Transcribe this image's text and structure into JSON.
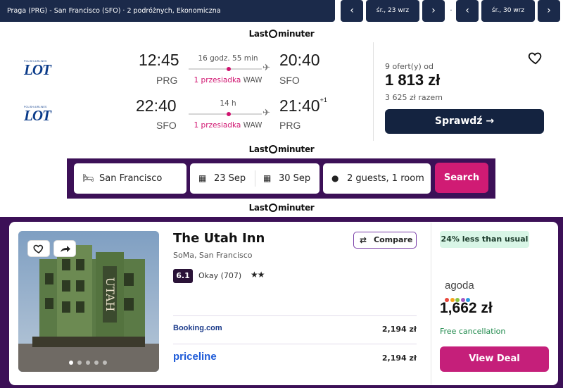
{
  "flight_search": {
    "route_summary": "Praga (PRG) - San Francisco (SFO)  ·  2 podróżnych, Ekonomiczna",
    "depart_date": "śr., 23 wrz",
    "return_date": "śr., 30 wrz",
    "separator": "·"
  },
  "brand": {
    "left": "Last",
    "right": "minuter"
  },
  "flight": {
    "airline": {
      "name": "LOT",
      "small": "POLISH AIRLINES"
    },
    "outbound": {
      "depart_time": "12:45",
      "depart_code": "PRG",
      "duration": "16 godz. 55 min",
      "stops_label": "1 przesiadka",
      "stop_code": "WAW",
      "arrive_time": "20:40",
      "arrive_code": "SFO",
      "day_offset": ""
    },
    "inbound": {
      "depart_time": "22:40",
      "depart_code": "SFO",
      "duration": "14 h",
      "stops_label": "1 przesiadka",
      "stop_code": "WAW",
      "arrive_time": "21:40",
      "arrive_code": "PRG",
      "day_offset": "+1"
    },
    "offers_label": "9 ofert(y) od",
    "price": "1 813 zł",
    "total_label": "3 625 zł razem",
    "check_label": "Sprawdź"
  },
  "hotel_search": {
    "destination": "San Francisco",
    "checkin": "23 Sep",
    "checkout": "30 Sep",
    "guests": "2 guests, 1 room",
    "search_label": "Search"
  },
  "hotel": {
    "name": "The Utah Inn",
    "location": "SoMa, San Francisco",
    "score": "6.1",
    "score_text": "Okay (707)",
    "stars": "★★",
    "compare_label": "Compare",
    "providers": [
      {
        "name": "Booking.com",
        "price": "2,194 zł"
      },
      {
        "name": "priceline",
        "price": "2,194 zł"
      }
    ],
    "deal_badge": "24% less than usual",
    "best_provider": "agoda",
    "best_price": "1,662 zł",
    "cancellation": "Free cancellation",
    "view_deal_label": "View Deal",
    "photo_sign": "UTAH",
    "photo_count": 5,
    "photo_active": 0
  },
  "colors": {
    "navy": "#1b2a4a",
    "accent_pink": "#d0136f",
    "purple": "#3c1057",
    "green": "#1f8a4c"
  }
}
